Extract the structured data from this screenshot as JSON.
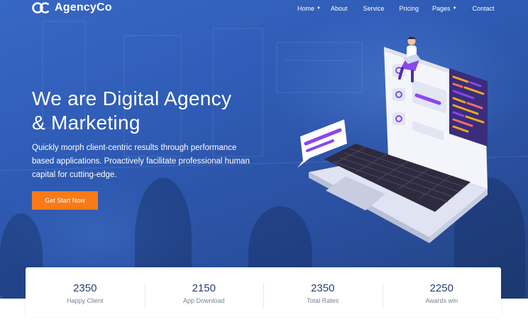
{
  "brand": {
    "name": "AgencyCo",
    "logo_icon": "agencyco-logo-icon"
  },
  "nav": {
    "items": [
      {
        "label": "Home",
        "has_dropdown": true
      },
      {
        "label": "About",
        "has_dropdown": false
      },
      {
        "label": "Service",
        "has_dropdown": false
      },
      {
        "label": "Pricing",
        "has_dropdown": false
      },
      {
        "label": "Pages",
        "has_dropdown": true
      },
      {
        "label": "Contact",
        "has_dropdown": false
      }
    ],
    "dropdown_glyph": "▼"
  },
  "hero": {
    "title_line1": "We are Digital Agency",
    "title_line2": "& Marketing",
    "description": "Quickly morph client-centric results through performance based applications. Proactively facilitate professional human capital for cutting-edge.",
    "cta_label": "Get Start Now"
  },
  "stats": [
    {
      "value": "2350",
      "label": "Happy Client"
    },
    {
      "value": "2150",
      "label": "App Download"
    },
    {
      "value": "2350",
      "label": "Total Rates"
    },
    {
      "value": "2250",
      "label": "Awards win"
    }
  ],
  "colors": {
    "hero_blue": "#2f5cb6",
    "accent_orange": "#f97a16",
    "stat_value": "#27406f",
    "stat_label": "#7b8290",
    "illustration_purple": "#8b46ee"
  }
}
